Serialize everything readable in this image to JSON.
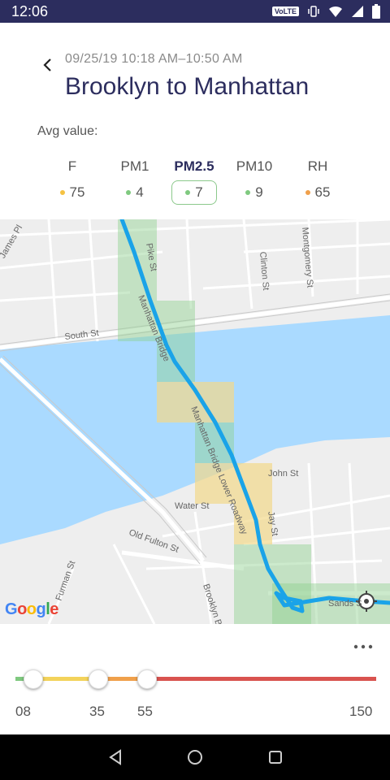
{
  "status_bar": {
    "time": "12:06",
    "network_badge": "VoLTE"
  },
  "header": {
    "date_range": "09/25/19 10:18 AM–10:50 AM",
    "title": "Brooklyn to Manhattan"
  },
  "avg": {
    "label": "Avg value:",
    "metrics": [
      {
        "name": "F",
        "value": "75",
        "color": "#f5c242",
        "selected": false
      },
      {
        "name": "PM1",
        "value": "4",
        "color": "#7fc97f",
        "selected": false
      },
      {
        "name": "PM2.5",
        "value": "7",
        "color": "#7fc97f",
        "selected": true
      },
      {
        "name": "PM10",
        "value": "9",
        "color": "#7fc97f",
        "selected": false
      },
      {
        "name": "RH",
        "value": "65",
        "color": "#f0a04b",
        "selected": false
      }
    ]
  },
  "map": {
    "streets": {
      "james_pl": "James Pl",
      "pike_st": "Pike St",
      "clinton_st": "Clinton St",
      "montgomery_st": "Montgomery St",
      "south_st": "South St",
      "manhattan_bridge": "Manhattan Bridge",
      "manhattan_bridge_lower": "Manhattan Bridge Lower Roadway",
      "john_st": "John St",
      "water_st": "Water St",
      "jay_st": "Jay St",
      "old_fulton_st": "Old Fulton St",
      "furman_st": "Furman St",
      "brooklyn_bri": "Brooklyn Bri",
      "sands": "Sands S"
    },
    "logo": "Google",
    "colors": {
      "water": "#aadaff",
      "route": "#1aa3e8",
      "good": "#8fd18f",
      "moderate": "#f2d98a"
    }
  },
  "scale": {
    "ticks": [
      "08",
      "35",
      "55",
      "150"
    ],
    "colors": {
      "green": "#7fc97f",
      "yellow": "#f3d35b",
      "orange": "#f0a04b",
      "red": "#d9534f"
    }
  }
}
